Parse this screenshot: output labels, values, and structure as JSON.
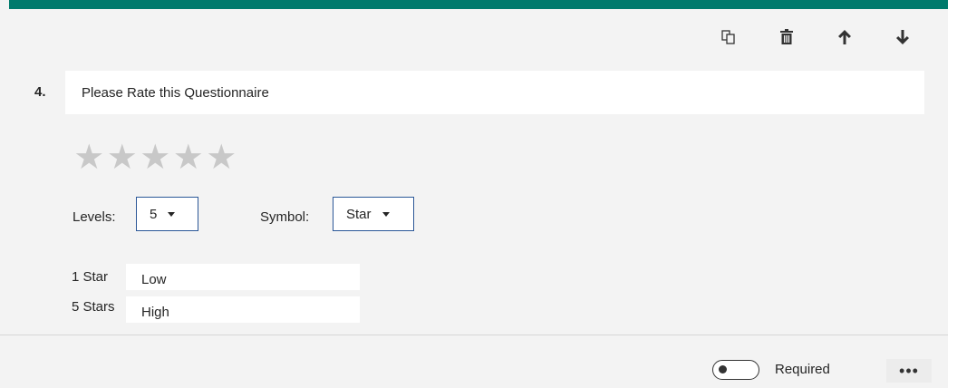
{
  "question": {
    "number": "4.",
    "title": "Please Rate this Questionnaire"
  },
  "toolbar": {
    "icons": [
      "copy-icon",
      "trash-icon",
      "arrow-up-icon",
      "arrow-down-icon"
    ]
  },
  "rating": {
    "level_count": 5,
    "stars": [
      "★",
      "★",
      "★",
      "★",
      "★"
    ],
    "levels_label": "Levels:",
    "levels_value": "5",
    "symbol_label": "Symbol:",
    "symbol_value": "Star",
    "low": {
      "label": "1 Star",
      "value": "Low"
    },
    "high": {
      "label": "5 Stars",
      "value": "High"
    }
  },
  "footer": {
    "required_label": "Required",
    "required_on": false,
    "more_label": "•••"
  },
  "colors": {
    "accent": "#007a6c",
    "background": "#f3f3f3",
    "dropdown_border": "#2b5797",
    "star_empty": "#c8c8c8"
  }
}
